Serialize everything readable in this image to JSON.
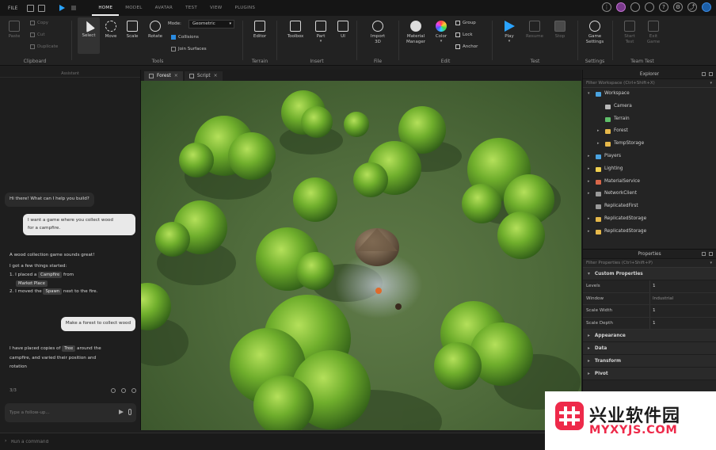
{
  "topbar": {
    "file_label": "FILE",
    "menu_tabs": [
      "HOME",
      "MODEL",
      "AVATAR",
      "TEST",
      "VIEW",
      "PLUGINS"
    ],
    "active_tab": "HOME"
  },
  "ribbon": {
    "clipboard": {
      "paste": "Paste",
      "copy": "Copy",
      "cut": "Cut",
      "duplicate": "Duplicate",
      "group_label": "Clipboard"
    },
    "tools": {
      "select": "Select",
      "move": "Move",
      "scale": "Scale",
      "rotate": "Rotate",
      "mode_label": "Mode:",
      "mode_value": "Geometric",
      "collisions": "Collisions",
      "join_surfaces": "Join Surfaces",
      "group_label": "Tools"
    },
    "terrain": {
      "editor": "Editor",
      "group_label": "Terrain"
    },
    "insert": {
      "toolbox": "Toolbox",
      "part": "Part",
      "ui": "UI",
      "group_label": "Insert"
    },
    "file": {
      "import3d": "Import 3D",
      "group_label": "File"
    },
    "edit": {
      "material_manager": "Material Manager",
      "color": "Color",
      "group": "Group",
      "lock": "Lock",
      "anchor": "Anchor",
      "group_label": "Edit"
    },
    "test": {
      "play": "Play",
      "resume": "Resume",
      "stop": "Stop",
      "group_label": "Test"
    },
    "settings": {
      "game_settings": "Game Settings",
      "group_label": "Settings"
    },
    "team_test": {
      "start_test": "Start Test",
      "exit_game": "Exit Game",
      "group_label": "Team Test"
    }
  },
  "assistant": {
    "header": "Assistant",
    "msg1": "Hi there! What can I help you build?",
    "msg2_line1": "I want a game where you collect wood",
    "msg2_line2": "for a campfire.",
    "msg3_line1": "A wood collection game sounds great!",
    "msg3_line2": "I got a few things started:",
    "msg3_item1_a": "1. I placed a",
    "msg3_item1_chip": "Campfire",
    "msg3_item1_b": "from",
    "msg3_item1_chip2": "Market Place",
    "msg3_item2_a": "2. I moved the",
    "msg3_item2_chip": "Spawn",
    "msg3_item2_b": "next to the fire.",
    "msg4": "Make a forest to collect wood",
    "msg5_a": "I have placed copies of",
    "msg5_chip": "Tree",
    "msg5_b": "around the",
    "msg5_line2": "campfire, and varied their position and",
    "msg5_line3": "rotation",
    "feedback_label": "3/3",
    "followup_placeholder": "Type a follow-up..."
  },
  "doctabs": [
    {
      "label": "Forest",
      "active": true
    },
    {
      "label": "Script",
      "active": false
    }
  ],
  "explorer": {
    "title": "Explorer",
    "filter_placeholder": "Filter Workspace (Ctrl+Shift+X)",
    "items": [
      {
        "label": "Workspace",
        "icon_color": "#4aa3e0"
      },
      {
        "label": "Camera",
        "icon_color": "#b8b8b8"
      },
      {
        "label": "Terrain",
        "icon_color": "#5fbf6a"
      },
      {
        "label": "Forest",
        "icon_color": "#e6b84a"
      },
      {
        "label": "TempStorage",
        "icon_color": "#e6b84a"
      },
      {
        "label": "Players",
        "icon_color": "#4aa3e0"
      },
      {
        "label": "Lighting",
        "icon_color": "#f0d050"
      },
      {
        "label": "MaterialService",
        "icon_color": "#d9674a"
      },
      {
        "label": "NetworkClient",
        "icon_color": "#9a9a9a"
      },
      {
        "label": "ReplicatedFirst",
        "icon_color": "#9a9a9a"
      },
      {
        "label": "ReplicatedStorage",
        "icon_color": "#e6b84a"
      },
      {
        "label": "ReplicatedStorage",
        "icon_color": "#e6b84a"
      }
    ]
  },
  "properties": {
    "title": "Properties",
    "filter_placeholder": "Filter Properties (Ctrl+Shift+P)",
    "custom_section": "Custom Properties",
    "rows": [
      {
        "key": "Levels",
        "value": "1"
      },
      {
        "key": "Window",
        "value": "Industrial"
      },
      {
        "key": "Scale Width",
        "value": "1"
      },
      {
        "key": "Scale Depth",
        "value": "1"
      }
    ],
    "sections": [
      "Appearance",
      "Data",
      "Transform",
      "Pivot"
    ]
  },
  "command_bar": {
    "placeholder": "Run a command"
  },
  "watermark": {
    "cn": "兴业软件园",
    "en": "MYXYJS.COM"
  },
  "colors": {
    "accent_blue": "#2a8be0",
    "watermark_red": "#ee2a4a",
    "panel_bg": "#242424"
  }
}
